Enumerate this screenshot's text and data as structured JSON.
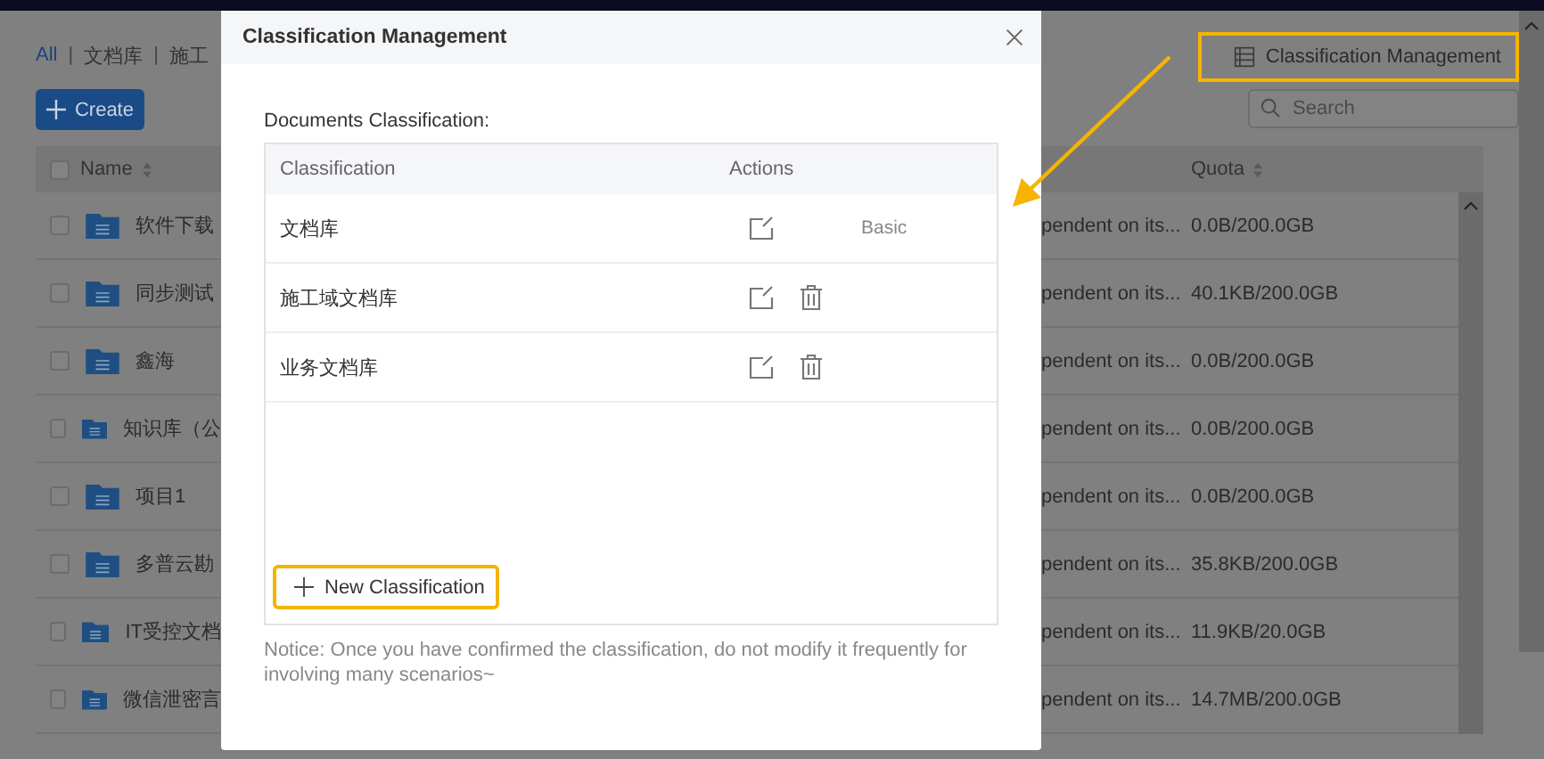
{
  "breadcrumb": [
    {
      "label": "All",
      "selected": true
    },
    {
      "label": "文档库",
      "selected": false
    },
    {
      "label": "施工",
      "selected": false
    }
  ],
  "breadcrumb_separator": "|",
  "create_button": {
    "label": "Create"
  },
  "select_all": {
    "checked": false
  },
  "classification_button": {
    "label": "Classification Management",
    "highlighted": true
  },
  "search": {
    "placeholder": "Search"
  },
  "file_table": {
    "columns": [
      "Name",
      "Quota"
    ],
    "rows": [
      {
        "name": "软件下载",
        "column_2": "pendent on its...",
        "quota": "0.0B/200.0GB",
        "checked": false
      },
      {
        "name": "同步测试",
        "column_2": "pendent on its...",
        "quota": "40.1KB/200.0GB",
        "checked": false
      },
      {
        "name": "鑫海",
        "column_2": "pendent on its...",
        "quota": "0.0B/200.0GB",
        "checked": false
      },
      {
        "name": "知识库（公",
        "column_2": "pendent on its...",
        "quota": "0.0B/200.0GB",
        "checked": false
      },
      {
        "name": "项目1",
        "column_2": "pendent on its...",
        "quota": "0.0B/200.0GB",
        "checked": false
      },
      {
        "name": "多普云勘",
        "column_2": "pendent on its...",
        "quota": "35.8KB/200.0GB",
        "checked": false
      },
      {
        "name": "IT受控文档",
        "column_2": "pendent on its...",
        "quota": "11.9KB/20.0GB",
        "checked": false
      },
      {
        "name": "微信泄密言",
        "column_2": "pendent on its...",
        "quota": "14.7MB/200.0GB",
        "checked": false
      }
    ]
  },
  "dialog": {
    "title": "Classification Management",
    "section_label": "Documents Classification:",
    "columns": [
      "Classification",
      "Actions"
    ],
    "rows": [
      {
        "name": "文档库",
        "deletable": false,
        "tag": "Basic"
      },
      {
        "name": "施工域文档库",
        "deletable": true
      },
      {
        "name": "业务文档库",
        "deletable": true
      }
    ],
    "new_button": {
      "label": "New Classification",
      "highlighted": true
    },
    "notice": "Notice: Once you have confirmed the classification, do not modify it frequently for involving many scenarios~"
  }
}
